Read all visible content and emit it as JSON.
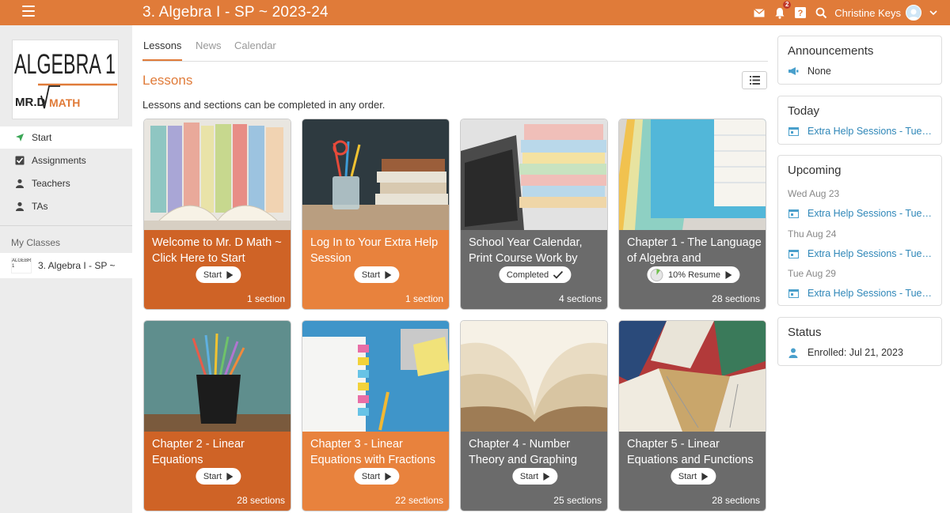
{
  "header": {
    "title": "3. Algebra I - SP ~ 2023-24",
    "notification_count": "2",
    "user_name": "Christine Keys",
    "accent": "#e07b39"
  },
  "sidebar": {
    "logo_text_main": "ALGEBRA 1",
    "logo_text_sub": "MR.D",
    "logo_text_sub2": "MATH",
    "nav": [
      {
        "label": "Start",
        "icon": "arrow-icon"
      },
      {
        "label": "Assignments",
        "icon": "checkbox-icon"
      },
      {
        "label": "Teachers",
        "icon": "person-icon"
      },
      {
        "label": "TAs",
        "icon": "person-icon"
      }
    ],
    "section_label": "My Classes",
    "class_item": "3. Algebra I - SP ~",
    "class_thumb": "ALGEBRA 1"
  },
  "tabs": [
    "Lessons",
    "News",
    "Calendar"
  ],
  "main": {
    "heading": "Lessons",
    "subtitle": "Lessons and sections can be completed in any order."
  },
  "cards": [
    {
      "title": "Welcome to Mr. D Math ~ Click Here to Start",
      "action": "Start",
      "count": "1 section",
      "style": "dark-orange"
    },
    {
      "title": "Log In to Your Extra Help Session",
      "action": "Start",
      "count": "1 section",
      "style": "light-orange"
    },
    {
      "title": "School Year Calendar, Print Course Work by",
      "action": "Completed",
      "count": "4 sections",
      "style": "gray"
    },
    {
      "title": "Chapter 1 - The Language of Algebra and",
      "action": "Resume",
      "progress": "10%",
      "count": "28 sections",
      "style": "gray"
    },
    {
      "title": "Chapter 2 - Linear Equations",
      "action": "Start",
      "count": "28 sections",
      "style": "dark-orange"
    },
    {
      "title": "Chapter 3 - Linear Equations with Fractions",
      "action": "Start",
      "count": "22 sections",
      "style": "light-orange"
    },
    {
      "title": "Chapter 4 - Number Theory and Graphing",
      "action": "Start",
      "count": "25 sections",
      "style": "gray"
    },
    {
      "title": "Chapter 5 - Linear Equations and Functions",
      "action": "Start",
      "count": "28 sections",
      "style": "gray"
    }
  ],
  "announcements": {
    "title": "Announcements",
    "value": "None"
  },
  "today": {
    "title": "Today",
    "event": "Extra Help Sessions - Tues, Wed, Thurs"
  },
  "upcoming": {
    "title": "Upcoming",
    "items": [
      {
        "date": "Wed Aug 23",
        "event": "Extra Help Sessions - Tues, Wed, Thurs"
      },
      {
        "date": "Thu Aug 24",
        "event": "Extra Help Sessions - Tues, Wed, Thurs"
      },
      {
        "date": "Tue Aug 29",
        "event": "Extra Help Sessions - Tues, Wed, Thurs"
      }
    ]
  },
  "status": {
    "title": "Status",
    "value": "Enrolled: Jul 21, 2023"
  }
}
